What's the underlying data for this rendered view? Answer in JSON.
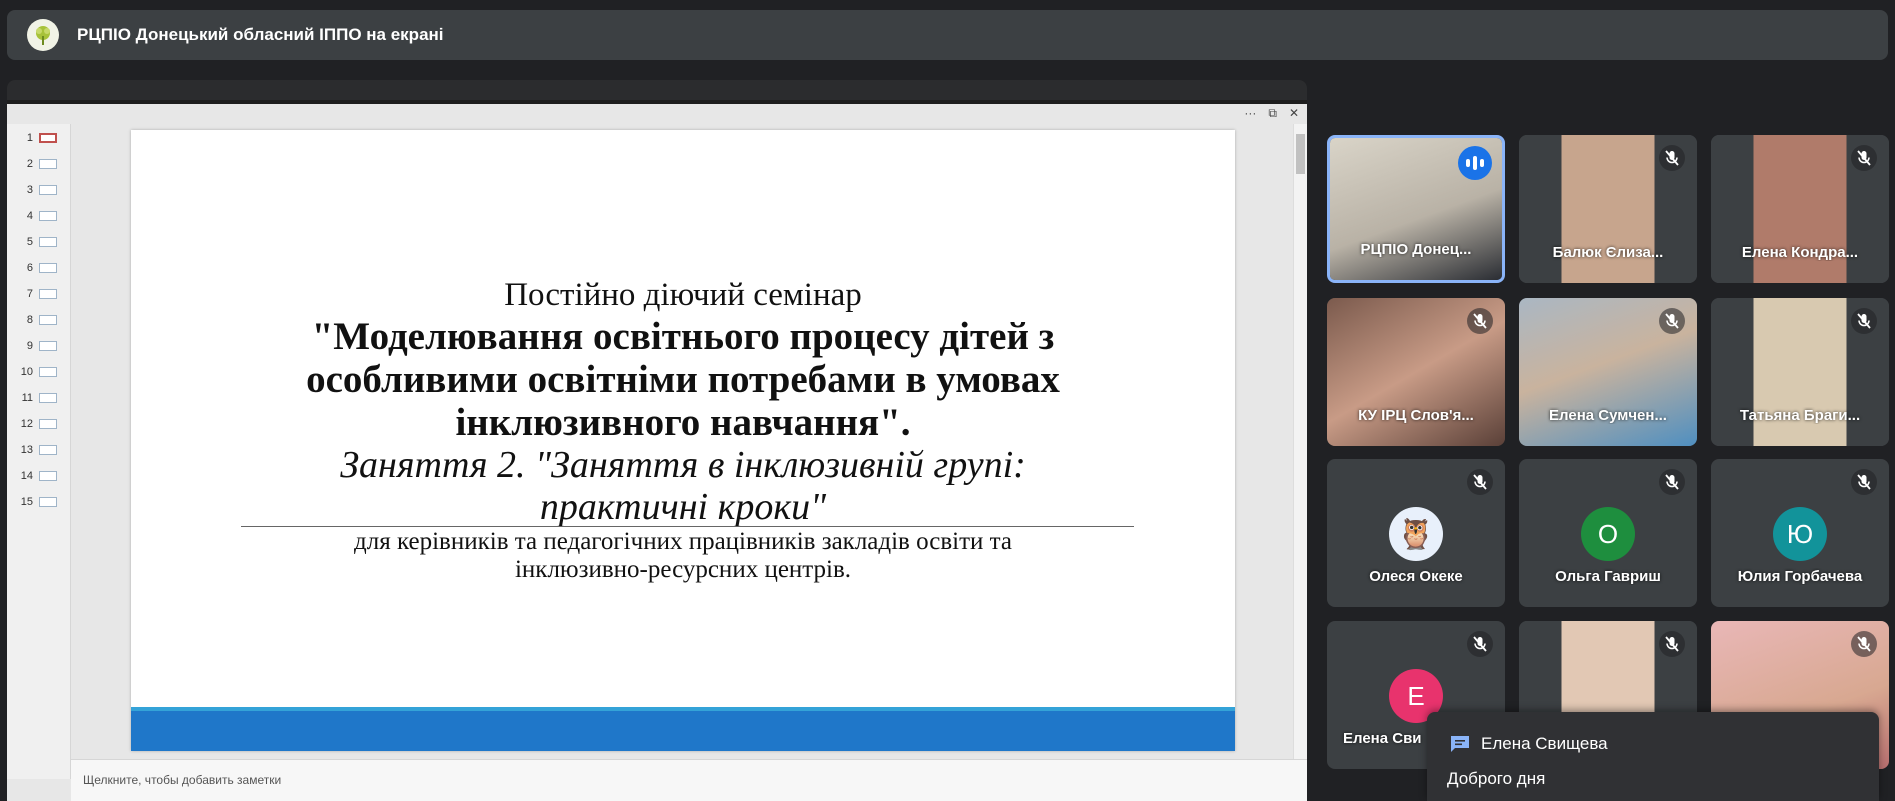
{
  "header": {
    "presenter_text": "РЦПІО Донецький обласний ІППО на екрані"
  },
  "slides_panel": {
    "numbers": [
      "1",
      "2",
      "3",
      "4",
      "5",
      "6",
      "7",
      "8",
      "9",
      "10",
      "11",
      "12",
      "13",
      "14",
      "15"
    ],
    "active": "1"
  },
  "slide": {
    "line1": "Постійно діючий семінар",
    "line2a": "\"Моделювання освітнього процесу дітей з",
    "line2b": "особливими освітніми потребами в умовах",
    "line2c": "інклюзивного навчання\".",
    "line3a": "Заняття 2. \"Заняття в інклюзивній групі:",
    "line3b": "практичні кроки\"",
    "line4a": "для керівників та педагогічних працівників закладів освіти та",
    "line4b": "інклюзивно-ресурсних центрів."
  },
  "notes_placeholder": "Щелкните, чтобы добавить заметки",
  "participants": [
    {
      "name": "РЦПІО Донец...",
      "muted": false,
      "speaking": true
    },
    {
      "name": "Балюк Єлиза...",
      "muted": true
    },
    {
      "name": "Елена Кондра...",
      "muted": true
    },
    {
      "name": "КУ ІРЦ Слов'я...",
      "muted": true
    },
    {
      "name": "Елена Сумчен...",
      "muted": true
    },
    {
      "name": "Татьяна Браги...",
      "muted": true
    },
    {
      "name": "Олеся Океке",
      "muted": true,
      "avatar_image": true
    },
    {
      "name": "Ольга Гавриш",
      "muted": true,
      "avatar_letter": "О",
      "avatar_color": "#1e8e3e"
    },
    {
      "name": "Юлия Горбачева",
      "muted": true,
      "avatar_letter": "Ю",
      "avatar_color": "#12939a"
    },
    {
      "name": "Елена Сви",
      "muted": true,
      "avatar_letter": "Е",
      "avatar_color": "#e8336d"
    },
    {
      "name": "",
      "muted": true
    },
    {
      "name": "",
      "muted": true
    }
  ],
  "chat": {
    "sender": "Елена Свищева",
    "message": "Доброго дня"
  },
  "colors": {
    "background": "#202124",
    "tile": "#3c4043",
    "accent": "#1a73e8",
    "slide_bar": "#1f77c9"
  }
}
